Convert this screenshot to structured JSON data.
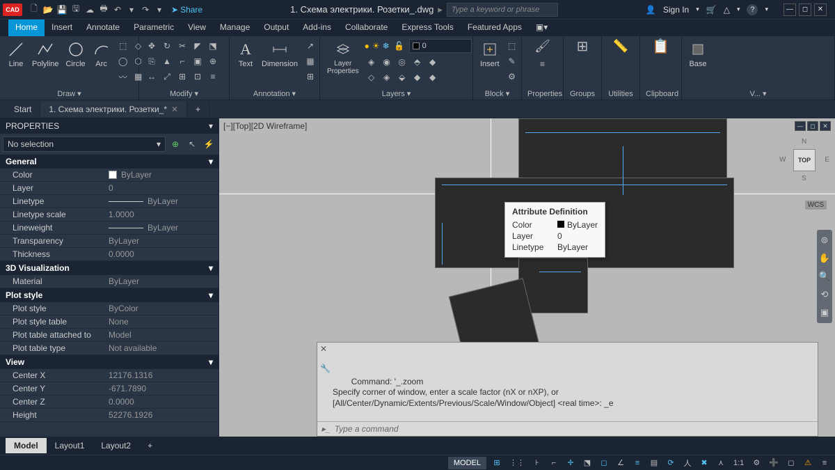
{
  "titlebar": {
    "app_badge": "A",
    "qat": [
      "new",
      "open",
      "save",
      "saveall",
      "plot",
      "undo",
      "redo"
    ],
    "share_label": "Share",
    "document_title": "1. Схема электрики. Розетки_.dwg",
    "search_placeholder": "Type a keyword or phrase",
    "signin_label": "Sign In",
    "help_icon": "?"
  },
  "ribbon_tabs": [
    "Home",
    "Insert",
    "Annotate",
    "Parametric",
    "View",
    "Manage",
    "Output",
    "Add-ins",
    "Collaborate",
    "Express Tools",
    "Featured Apps"
  ],
  "ribbon_active": "Home",
  "ribbon_panels": {
    "draw": {
      "label": "Draw ▾",
      "tools": [
        "Line",
        "Polyline",
        "Circle",
        "Arc"
      ]
    },
    "modify": {
      "label": "Modify ▾"
    },
    "annotation": {
      "label": "Annotation ▾",
      "tools": [
        "Text",
        "Dimension"
      ]
    },
    "layers": {
      "label": "Layers ▾",
      "tool": "Layer Properties",
      "current": "0"
    },
    "block": {
      "label": "Block ▾",
      "tool": "Insert"
    },
    "properties": {
      "label": "Properties"
    },
    "groups": {
      "label": "Groups"
    },
    "utilities": {
      "label": "Utilities"
    },
    "clipboard": {
      "label": "Clipboard"
    },
    "view": {
      "label": "V... ▾",
      "tool": "Base"
    }
  },
  "file_tabs": [
    {
      "label": "Start",
      "active": false
    },
    {
      "label": "1. Схема электрики. Розетки_*",
      "active": true
    }
  ],
  "file_tab_add": "+",
  "properties_panel": {
    "header": "PROPERTIES",
    "selection": "No selection",
    "sections": [
      {
        "title": "General",
        "rows": [
          {
            "label": "Color",
            "value": "ByLayer",
            "swatch": true
          },
          {
            "label": "Layer",
            "value": "0"
          },
          {
            "label": "Linetype",
            "value": "ByLayer",
            "line": true
          },
          {
            "label": "Linetype scale",
            "value": "1.0000"
          },
          {
            "label": "Lineweight",
            "value": "ByLayer",
            "line": true
          },
          {
            "label": "Transparency",
            "value": "ByLayer"
          },
          {
            "label": "Thickness",
            "value": "0.0000"
          }
        ]
      },
      {
        "title": "3D Visualization",
        "rows": [
          {
            "label": "Material",
            "value": "ByLayer"
          }
        ]
      },
      {
        "title": "Plot style",
        "rows": [
          {
            "label": "Plot style",
            "value": "ByColor"
          },
          {
            "label": "Plot style table",
            "value": "None"
          },
          {
            "label": "Plot table attached to",
            "value": "Model"
          },
          {
            "label": "Plot table type",
            "value": "Not available"
          }
        ]
      },
      {
        "title": "View",
        "rows": [
          {
            "label": "Center X",
            "value": "12176.1316"
          },
          {
            "label": "Center Y",
            "value": "-671.7890"
          },
          {
            "label": "Center Z",
            "value": "0.0000"
          },
          {
            "label": "Height",
            "value": "52276.1926"
          }
        ]
      }
    ]
  },
  "viewport": {
    "label": "[−][Top][2D Wireframe]",
    "viewcube": {
      "face": "TOP",
      "n": "N",
      "s": "S",
      "e": "E",
      "w": "W"
    },
    "wcs": "WCS"
  },
  "tooltip": {
    "title": "Attribute Definition",
    "rows": [
      {
        "label": "Color",
        "value": "ByLayer",
        "swatch": true
      },
      {
        "label": "Layer",
        "value": "0"
      },
      {
        "label": "Linetype",
        "value": "ByLayer"
      }
    ]
  },
  "commandline": {
    "history": "Command: '_.zoom\nSpecify corner of window, enter a scale factor (nX or nXP), or\n[All/Center/Dynamic/Extents/Previous/Scale/Window/Object] <real time>: _e",
    "prompt_placeholder": "Type a command"
  },
  "layout_tabs": [
    "Model",
    "Layout1",
    "Layout2"
  ],
  "layout_active": "Model",
  "layout_add": "+",
  "statusbar": {
    "model": "MODEL",
    "scale": "1:1",
    "buttons": [
      "grid",
      "snap",
      "infer",
      "ortho",
      "polar",
      "iso",
      "osnap",
      "3dosnap",
      "otrack",
      "lwt",
      "trans",
      "cycle",
      "ann",
      "auto",
      "ws",
      "monitor",
      "units",
      "qprop",
      "clean",
      "custom"
    ]
  }
}
